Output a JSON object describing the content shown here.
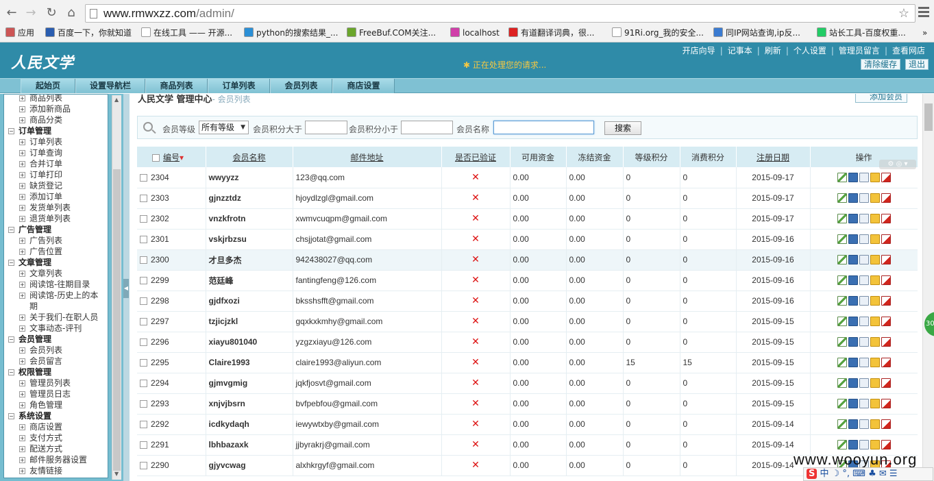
{
  "browser": {
    "url_host": "www.rmwxzz.com",
    "url_path": "/admin/",
    "bookmarks": [
      "应用",
      "百度一下，你就知道",
      "在线工具 —— 开源...",
      "python的搜索结果_...",
      "FreeBuf.COM关注...",
      "localhost",
      "有道翻译词典，很...",
      "91Ri.org_我的安全...",
      "同IP网站查询,ip反...",
      "站长工具-百度权重..."
    ],
    "bookmark_overflow": "»"
  },
  "header": {
    "logo": "人民文学",
    "processing": "正在处理您的请求...",
    "top_links": [
      "开店向导",
      "记事本",
      "刷新",
      "个人设置",
      "管理员留言",
      "查看网店"
    ],
    "clear_cache": "清除缓存",
    "logout": "退出"
  },
  "nav_tabs": [
    "起始页",
    "设置导航栏",
    "商品列表",
    "订单列表",
    "会员列表",
    "商店设置"
  ],
  "tree": [
    {
      "type": "leaf",
      "label": "商品列表"
    },
    {
      "type": "leaf",
      "label": "添加新商品"
    },
    {
      "type": "leaf",
      "label": "商品分类"
    },
    {
      "type": "group",
      "label": "订单管理"
    },
    {
      "type": "leaf",
      "label": "订单列表"
    },
    {
      "type": "leaf",
      "label": "订单查询"
    },
    {
      "type": "leaf",
      "label": "合并订单"
    },
    {
      "type": "leaf",
      "label": "订单打印"
    },
    {
      "type": "leaf",
      "label": "缺货登记"
    },
    {
      "type": "leaf",
      "label": "添加订单"
    },
    {
      "type": "leaf",
      "label": "发货单列表"
    },
    {
      "type": "leaf",
      "label": "退货单列表"
    },
    {
      "type": "group",
      "label": "广告管理"
    },
    {
      "type": "leaf",
      "label": "广告列表"
    },
    {
      "type": "leaf",
      "label": "广告位置"
    },
    {
      "type": "group",
      "label": "文章管理"
    },
    {
      "type": "leaf",
      "label": "文章列表"
    },
    {
      "type": "leaf",
      "label": "阅读馆-往期目录"
    },
    {
      "type": "leaf",
      "label": "阅读馆-历史上的本"
    },
    {
      "type": "cont",
      "label": "期"
    },
    {
      "type": "leaf",
      "label": "关于我们-在职人员"
    },
    {
      "type": "leaf",
      "label": "文事动态-评刊"
    },
    {
      "type": "group",
      "label": "会员管理"
    },
    {
      "type": "leaf",
      "label": "会员列表"
    },
    {
      "type": "leaf",
      "label": "会员留言"
    },
    {
      "type": "group",
      "label": "权限管理"
    },
    {
      "type": "leaf",
      "label": "管理员列表"
    },
    {
      "type": "leaf",
      "label": "管理员日志"
    },
    {
      "type": "leaf",
      "label": "角色管理"
    },
    {
      "type": "group",
      "label": "系统设置"
    },
    {
      "type": "leaf",
      "label": "商店设置"
    },
    {
      "type": "leaf",
      "label": "支付方式"
    },
    {
      "type": "leaf",
      "label": "配送方式"
    },
    {
      "type": "leaf",
      "label": "邮件服务器设置"
    },
    {
      "type": "leaf",
      "label": "友情链接"
    }
  ],
  "content": {
    "title": "人民文学 管理中心",
    "subtitle": "- 会员列表",
    "add_button": "添加会员"
  },
  "search": {
    "level_label": "会员等级",
    "level_value": "所有等级",
    "points_gt_label": "会员积分大于",
    "points_lt_label": "会员积分小于",
    "name_label": "会员名称",
    "button": "搜索"
  },
  "table": {
    "columns": [
      "编号",
      "会员名称",
      "邮件地址",
      "是否已验证",
      "可用资金",
      "冻结资金",
      "等级积分",
      "消费积分",
      "注册日期",
      "操作"
    ],
    "rows": [
      {
        "id": "2304",
        "name": "wwyyzz",
        "email": "123@qq.com",
        "verified": "✕",
        "funds": "0.00",
        "frozen": "0.00",
        "level": "0",
        "spend": "0",
        "date": "2015-09-17"
      },
      {
        "id": "2303",
        "name": "gjnzztdz",
        "email": "hjoydlzgl@gmail.com",
        "verified": "✕",
        "funds": "0.00",
        "frozen": "0.00",
        "level": "0",
        "spend": "0",
        "date": "2015-09-17"
      },
      {
        "id": "2302",
        "name": "vnzkfrotn",
        "email": "xwmvcuqpm@gmail.com",
        "verified": "✕",
        "funds": "0.00",
        "frozen": "0.00",
        "level": "0",
        "spend": "0",
        "date": "2015-09-17"
      },
      {
        "id": "2301",
        "name": "vskjrbzsu",
        "email": "chsjjotat@gmail.com",
        "verified": "✕",
        "funds": "0.00",
        "frozen": "0.00",
        "level": "0",
        "spend": "0",
        "date": "2015-09-16"
      },
      {
        "id": "2300",
        "name": "才旦多杰",
        "email": "942438027@qq.com",
        "verified": "✕",
        "funds": "0.00",
        "frozen": "0.00",
        "level": "0",
        "spend": "0",
        "date": "2015-09-16"
      },
      {
        "id": "2299",
        "name": "范廷峰",
        "email": "fantingfeng@126.com",
        "verified": "✕",
        "funds": "0.00",
        "frozen": "0.00",
        "level": "0",
        "spend": "0",
        "date": "2015-09-16"
      },
      {
        "id": "2298",
        "name": "gjdfxozi",
        "email": "bksshsfft@gmail.com",
        "verified": "✕",
        "funds": "0.00",
        "frozen": "0.00",
        "level": "0",
        "spend": "0",
        "date": "2015-09-16"
      },
      {
        "id": "2297",
        "name": "tzjicjzkl",
        "email": "gqxkxkmhy@gmail.com",
        "verified": "✕",
        "funds": "0.00",
        "frozen": "0.00",
        "level": "0",
        "spend": "0",
        "date": "2015-09-15"
      },
      {
        "id": "2296",
        "name": "xiayu801040",
        "email": "yzgzxiayu@126.com",
        "verified": "✕",
        "funds": "0.00",
        "frozen": "0.00",
        "level": "0",
        "spend": "0",
        "date": "2015-09-15"
      },
      {
        "id": "2295",
        "name": "Claire1993",
        "email": "claire1993@aliyun.com",
        "verified": "✕",
        "funds": "0.00",
        "frozen": "0.00",
        "level": "15",
        "spend": "15",
        "date": "2015-09-15"
      },
      {
        "id": "2294",
        "name": "gjmvgmig",
        "email": "jqkfjosvt@gmail.com",
        "verified": "✕",
        "funds": "0.00",
        "frozen": "0.00",
        "level": "0",
        "spend": "0",
        "date": "2015-09-15"
      },
      {
        "id": "2293",
        "name": "xnjvjbsrn",
        "email": "bvfpebfou@gmail.com",
        "verified": "✕",
        "funds": "0.00",
        "frozen": "0.00",
        "level": "0",
        "spend": "0",
        "date": "2015-09-15"
      },
      {
        "id": "2292",
        "name": "icdkydaqh",
        "email": "iewywtxby@gmail.com",
        "verified": "✕",
        "funds": "0.00",
        "frozen": "0.00",
        "level": "0",
        "spend": "0",
        "date": "2015-09-14"
      },
      {
        "id": "2291",
        "name": "lbhbazaxk",
        "email": "jjbyrakrj@gmail.com",
        "verified": "✕",
        "funds": "0.00",
        "frozen": "0.00",
        "level": "0",
        "spend": "0",
        "date": "2015-09-14"
      },
      {
        "id": "2290",
        "name": "gjyvcwag",
        "email": "alxhkrgyf@gmail.com",
        "verified": "✕",
        "funds": "0.00",
        "frozen": "0.00",
        "level": "0",
        "spend": "0",
        "date": "2015-09-14"
      }
    ]
  },
  "overlay": {
    "watermark": "www.wooyun.org",
    "ime_text": "中 ☽ °, ⌨ ♣ ✉ ☰",
    "badge_text": "30"
  }
}
